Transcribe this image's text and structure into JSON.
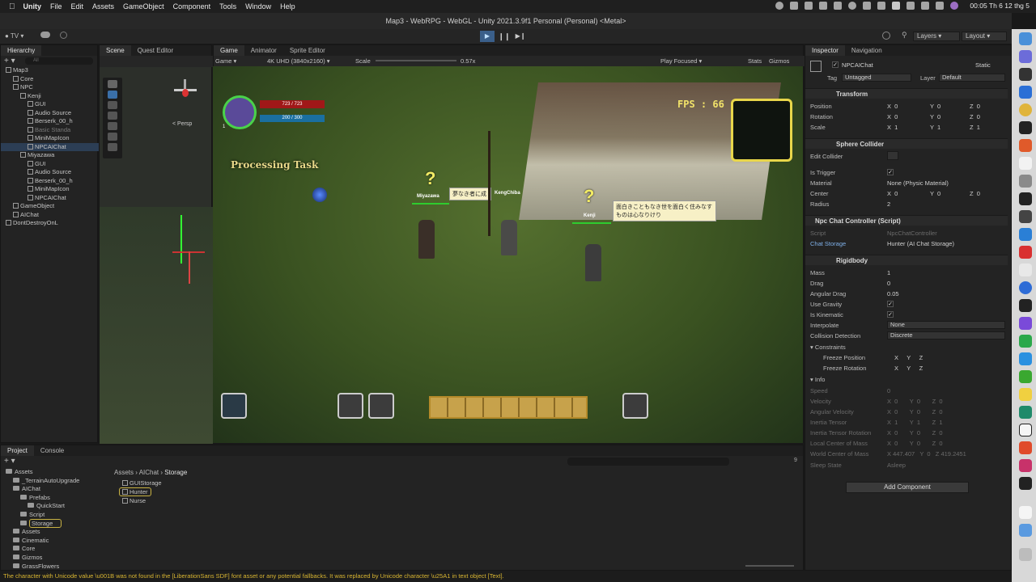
{
  "menubar": {
    "app_name": "Unity",
    "items": [
      "File",
      "Edit",
      "Assets",
      "GameObject",
      "Component",
      "Tools",
      "Window",
      "Help"
    ],
    "clock": "00:05 Th 6 12 thg 5"
  },
  "title": "Map3 - WebRPG - WebGL - Unity 2021.3.9f1 Personal (Personal) <Metal>",
  "toolbar": {
    "account": "TV",
    "layers": "Layers",
    "layout": "Layout"
  },
  "hierarchy": {
    "tab": "Hierarchy",
    "search_placeholder": "All",
    "items": [
      {
        "label": "Map3",
        "indent": 0
      },
      {
        "label": "Core",
        "indent": 1
      },
      {
        "label": "NPC",
        "indent": 1
      },
      {
        "label": "Kenji",
        "indent": 2
      },
      {
        "label": "GUI",
        "indent": 3
      },
      {
        "label": "Audio Source",
        "indent": 3
      },
      {
        "label": "Berserk_00_h",
        "indent": 3
      },
      {
        "label": "Basic Standa",
        "indent": 3,
        "muted": true
      },
      {
        "label": "MiniMapIcon",
        "indent": 3
      },
      {
        "label": "NPCAIChat",
        "indent": 3,
        "selected": true
      },
      {
        "label": "Miyazawa",
        "indent": 2
      },
      {
        "label": "GUI",
        "indent": 3
      },
      {
        "label": "Audio Source",
        "indent": 3
      },
      {
        "label": "Berserk_00_h",
        "indent": 3
      },
      {
        "label": "MiniMapIcon",
        "indent": 3
      },
      {
        "label": "NPCAIChat",
        "indent": 3
      },
      {
        "label": "GameObject",
        "indent": 1
      },
      {
        "label": "AIChat",
        "indent": 1
      },
      {
        "label": "DontDestroyOnL",
        "indent": 0
      }
    ]
  },
  "scene": {
    "tabs": [
      "Scene",
      "Quest Editor"
    ],
    "persp": "< Persp"
  },
  "game": {
    "tabs": [
      "Game",
      "Animator",
      "Sprite Editor"
    ],
    "display": "Game",
    "resolution": "4K UHD (3840x2160)",
    "scale_label": "Scale",
    "scale_value": "0.57x",
    "play_focused": "Play Focused",
    "stats": "Stats",
    "gizmos": "Gizmos",
    "hud": {
      "hp": "723 / 723",
      "mp": "200 / 300",
      "fps": "FPS : 66",
      "processing": "Processing Task",
      "npc1_name": "Miyazawa",
      "npc1_speech": "夢なき者に成",
      "npc2_name": "Kenji",
      "npc2_speech": "面白きこともなき世を面白く住みなすものは心なりけり",
      "npc3_name": "KengChiba",
      "level": "1"
    }
  },
  "project": {
    "tabs": [
      "Project",
      "Console"
    ],
    "tree": [
      {
        "label": "Assets",
        "indent": 0
      },
      {
        "label": "_TerrainAutoUpgrade",
        "indent": 1
      },
      {
        "label": "AIChat",
        "indent": 1
      },
      {
        "label": "Prefabs",
        "indent": 2
      },
      {
        "label": "QuickStart",
        "indent": 3
      },
      {
        "label": "Script",
        "indent": 2
      },
      {
        "label": "Storage",
        "indent": 2,
        "selected": true
      },
      {
        "label": "Assets",
        "indent": 1
      },
      {
        "label": "Cinematic",
        "indent": 1
      },
      {
        "label": "Core",
        "indent": 1
      },
      {
        "label": "Gizmos",
        "indent": 1
      },
      {
        "label": "GrassFlowers",
        "indent": 1
      }
    ],
    "breadcrumb": [
      "Assets",
      "AIChat",
      "Storage"
    ],
    "files": [
      "GUIStorage",
      "Hunter",
      "Nurse"
    ],
    "item_count": "9"
  },
  "inspector": {
    "tabs": [
      "Inspector",
      "Navigation"
    ],
    "object_name": "NPCAIChat",
    "static": "Static",
    "tag_label": "Tag",
    "tag": "Untagged",
    "layer_label": "Layer",
    "layer": "Default",
    "transform": {
      "title": "Transform",
      "position": [
        "0",
        "0",
        "0"
      ],
      "rotation": [
        "0",
        "0",
        "0"
      ],
      "scale": [
        "1",
        "1",
        "1"
      ]
    },
    "sphere": {
      "title": "Sphere Collider",
      "edit_collider": "Edit Collider",
      "is_trigger": "Is Trigger",
      "material_label": "Material",
      "material": "None (Physic Material)",
      "center_label": "Center",
      "center": [
        "0",
        "0",
        "0"
      ],
      "radius_label": "Radius",
      "radius": "2"
    },
    "npc": {
      "title": "Npc Chat Controller (Script)",
      "script_label": "Script",
      "script": "NpcChatController",
      "storage_label": "Chat Storage",
      "storage": "Hunter (AI Chat Storage)"
    },
    "rigidbody": {
      "title": "Rigidbody",
      "mass": "1",
      "drag": "0",
      "angular_drag": "0.05",
      "interpolate": "None",
      "collision": "Discrete",
      "freeze_position": "Freeze Position",
      "freeze_rotation": "Freeze Rotation",
      "info": "Info",
      "speed": "0",
      "velocity": [
        "0",
        "0",
        "0"
      ],
      "angular_velocity": [
        "0",
        "0",
        "0"
      ],
      "inertia_tensor": [
        "1",
        "1",
        "1"
      ],
      "inertia_tensor_rotation": [
        "0",
        "0",
        "0"
      ],
      "local_center": [
        "0",
        "0",
        "0"
      ],
      "world_center": [
        "447.407",
        "0",
        "419.2451"
      ],
      "sleep_state": "Asleep"
    },
    "add_component": "Add Component"
  },
  "status_message": "The character with Unicode value \\u001B was not found in the [LiberationSans SDF] font asset or any potential fallbacks. It was replaced by Unicode character \\u25A1 in text object [Text]."
}
